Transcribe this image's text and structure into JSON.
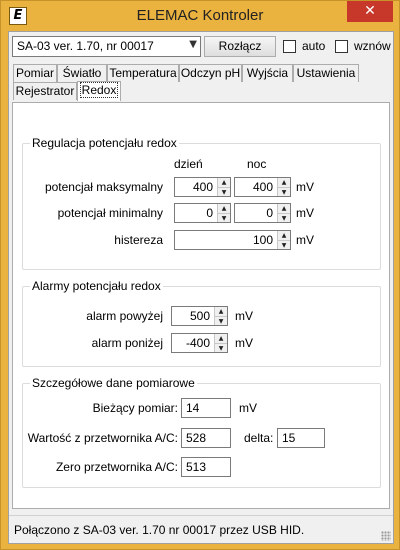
{
  "window": {
    "title": "ELEMAC Kontroler",
    "icon_letter": "E",
    "close_glyph": "✕"
  },
  "toolbar": {
    "device_select": "SA-03 ver. 1.70, nr 00017",
    "connect_label": "Rozłącz",
    "auto_label": "auto",
    "resume_label": "wznów"
  },
  "tabs": {
    "row1": [
      "Pomiar",
      "Światło",
      "Temperatura",
      "Odczyn pH",
      "Wyjścia",
      "Ustawienia"
    ],
    "row2": [
      "Rejestrator",
      "Redox"
    ],
    "active": "Redox"
  },
  "regulation": {
    "title": "Regulacja potencjału redox",
    "col_day": "dzień",
    "col_night": "noc",
    "max_label": "potencjał maksymalny",
    "max_day": "400",
    "max_night": "400",
    "min_label": "potencjał minimalny",
    "min_day": "0",
    "min_night": "0",
    "hyst_label": "histereza",
    "hyst_value": "100",
    "unit": "mV"
  },
  "alarms": {
    "title": "Alarmy potencjału redox",
    "high_label": "alarm powyżej",
    "high_value": "500",
    "low_label": "alarm poniżej",
    "low_value": "-400",
    "unit": "mV"
  },
  "details": {
    "title": "Szczegółowe dane pomiarowe",
    "current_label": "Bieżący pomiar:",
    "current_value": "14",
    "current_unit": "mV",
    "adc_label": "Wartość z przetwornika A/C:",
    "adc_value": "528",
    "delta_label": "delta:",
    "delta_value": "15",
    "zero_label": "Zero przetwornika A/C:",
    "zero_value": "513"
  },
  "status": {
    "text": "Połączono z SA-03 ver. 1.70 nr 00017 przez USB HID."
  },
  "colors": {
    "titlebar": "#eab23f",
    "close": "#c7372a",
    "client": "#f0f0f0"
  }
}
